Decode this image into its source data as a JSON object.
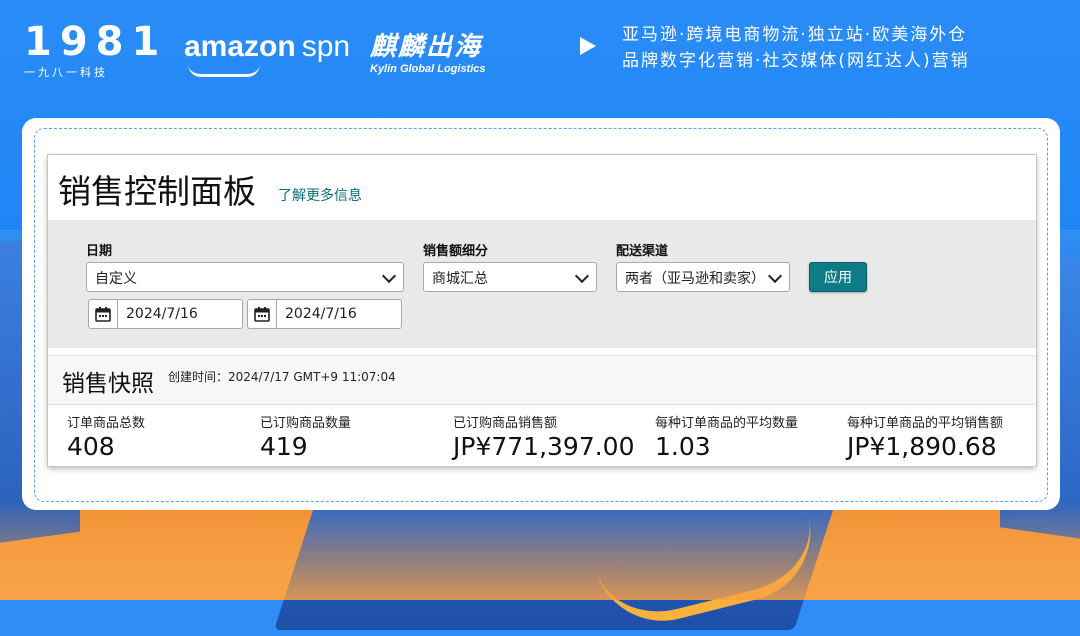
{
  "header": {
    "logo_1981_digits": "1981",
    "logo_1981_sub": "一九八一科技",
    "amazon_logo": "amazon",
    "amazon_spn": "spn",
    "kylin_cn": "麒麟出海",
    "kylin_en": "Kylin Global Logistics",
    "slogan_line1": "亚马逊·跨境电商物流·独立站·欧美海外仓",
    "slogan_line2": "品牌数字化营销·社交媒体(网红达人)营销"
  },
  "dashboard": {
    "title": "销售控制面板",
    "learn_more": "了解更多信息"
  },
  "filters": {
    "date_label": "日期",
    "date_value": "自定义",
    "start_date": "2024/7/16",
    "end_date": "2024/7/16",
    "sales_breakdown_label": "销售额细分",
    "sales_breakdown_value": "商城汇总",
    "fulfillment_label": "配送渠道",
    "fulfillment_value": "两者（亚马逊和卖家）",
    "apply_label": "应用"
  },
  "snapshot": {
    "title": "销售快照",
    "created_time": "创建时间：2024/7/17 GMT+9 11:07:04",
    "metrics": [
      {
        "label": "订单商品总数",
        "value": "408"
      },
      {
        "label": "已订购商品数量",
        "value": "419"
      },
      {
        "label": "已订购商品销售额",
        "value": "JP¥771,397.00"
      },
      {
        "label": "每种订单商品的平均数量",
        "value": "1.03"
      },
      {
        "label": "每种订单商品的平均销售额",
        "value": "JP¥1,890.68"
      }
    ]
  },
  "colors": {
    "brand_blue": "#2a8cf7",
    "apply_button": "#0f7b86",
    "learn_link": "#0b6e7a"
  },
  "icons": [
    "calendar-icon",
    "chevron-down-icon",
    "play-icon"
  ]
}
